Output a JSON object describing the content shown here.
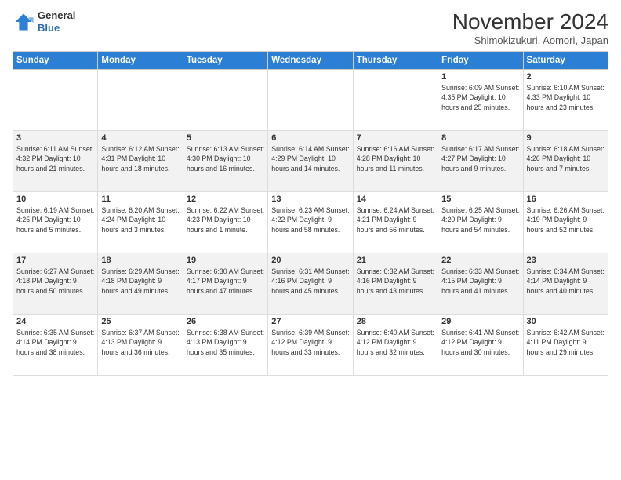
{
  "logo": {
    "general": "General",
    "blue": "Blue"
  },
  "title": "November 2024",
  "subtitle": "Shimokizukuri, Aomori, Japan",
  "days_of_week": [
    "Sunday",
    "Monday",
    "Tuesday",
    "Wednesday",
    "Thursday",
    "Friday",
    "Saturday"
  ],
  "weeks": [
    [
      {
        "day": "",
        "info": ""
      },
      {
        "day": "",
        "info": ""
      },
      {
        "day": "",
        "info": ""
      },
      {
        "day": "",
        "info": ""
      },
      {
        "day": "",
        "info": ""
      },
      {
        "day": "1",
        "info": "Sunrise: 6:09 AM\nSunset: 4:35 PM\nDaylight: 10 hours and 25 minutes."
      },
      {
        "day": "2",
        "info": "Sunrise: 6:10 AM\nSunset: 4:33 PM\nDaylight: 10 hours and 23 minutes."
      }
    ],
    [
      {
        "day": "3",
        "info": "Sunrise: 6:11 AM\nSunset: 4:32 PM\nDaylight: 10 hours and 21 minutes."
      },
      {
        "day": "4",
        "info": "Sunrise: 6:12 AM\nSunset: 4:31 PM\nDaylight: 10 hours and 18 minutes."
      },
      {
        "day": "5",
        "info": "Sunrise: 6:13 AM\nSunset: 4:30 PM\nDaylight: 10 hours and 16 minutes."
      },
      {
        "day": "6",
        "info": "Sunrise: 6:14 AM\nSunset: 4:29 PM\nDaylight: 10 hours and 14 minutes."
      },
      {
        "day": "7",
        "info": "Sunrise: 6:16 AM\nSunset: 4:28 PM\nDaylight: 10 hours and 11 minutes."
      },
      {
        "day": "8",
        "info": "Sunrise: 6:17 AM\nSunset: 4:27 PM\nDaylight: 10 hours and 9 minutes."
      },
      {
        "day": "9",
        "info": "Sunrise: 6:18 AM\nSunset: 4:26 PM\nDaylight: 10 hours and 7 minutes."
      }
    ],
    [
      {
        "day": "10",
        "info": "Sunrise: 6:19 AM\nSunset: 4:25 PM\nDaylight: 10 hours and 5 minutes."
      },
      {
        "day": "11",
        "info": "Sunrise: 6:20 AM\nSunset: 4:24 PM\nDaylight: 10 hours and 3 minutes."
      },
      {
        "day": "12",
        "info": "Sunrise: 6:22 AM\nSunset: 4:23 PM\nDaylight: 10 hours and 1 minute."
      },
      {
        "day": "13",
        "info": "Sunrise: 6:23 AM\nSunset: 4:22 PM\nDaylight: 9 hours and 58 minutes."
      },
      {
        "day": "14",
        "info": "Sunrise: 6:24 AM\nSunset: 4:21 PM\nDaylight: 9 hours and 56 minutes."
      },
      {
        "day": "15",
        "info": "Sunrise: 6:25 AM\nSunset: 4:20 PM\nDaylight: 9 hours and 54 minutes."
      },
      {
        "day": "16",
        "info": "Sunrise: 6:26 AM\nSunset: 4:19 PM\nDaylight: 9 hours and 52 minutes."
      }
    ],
    [
      {
        "day": "17",
        "info": "Sunrise: 6:27 AM\nSunset: 4:18 PM\nDaylight: 9 hours and 50 minutes."
      },
      {
        "day": "18",
        "info": "Sunrise: 6:29 AM\nSunset: 4:18 PM\nDaylight: 9 hours and 49 minutes."
      },
      {
        "day": "19",
        "info": "Sunrise: 6:30 AM\nSunset: 4:17 PM\nDaylight: 9 hours and 47 minutes."
      },
      {
        "day": "20",
        "info": "Sunrise: 6:31 AM\nSunset: 4:16 PM\nDaylight: 9 hours and 45 minutes."
      },
      {
        "day": "21",
        "info": "Sunrise: 6:32 AM\nSunset: 4:16 PM\nDaylight: 9 hours and 43 minutes."
      },
      {
        "day": "22",
        "info": "Sunrise: 6:33 AM\nSunset: 4:15 PM\nDaylight: 9 hours and 41 minutes."
      },
      {
        "day": "23",
        "info": "Sunrise: 6:34 AM\nSunset: 4:14 PM\nDaylight: 9 hours and 40 minutes."
      }
    ],
    [
      {
        "day": "24",
        "info": "Sunrise: 6:35 AM\nSunset: 4:14 PM\nDaylight: 9 hours and 38 minutes."
      },
      {
        "day": "25",
        "info": "Sunrise: 6:37 AM\nSunset: 4:13 PM\nDaylight: 9 hours and 36 minutes."
      },
      {
        "day": "26",
        "info": "Sunrise: 6:38 AM\nSunset: 4:13 PM\nDaylight: 9 hours and 35 minutes."
      },
      {
        "day": "27",
        "info": "Sunrise: 6:39 AM\nSunset: 4:12 PM\nDaylight: 9 hours and 33 minutes."
      },
      {
        "day": "28",
        "info": "Sunrise: 6:40 AM\nSunset: 4:12 PM\nDaylight: 9 hours and 32 minutes."
      },
      {
        "day": "29",
        "info": "Sunrise: 6:41 AM\nSunset: 4:12 PM\nDaylight: 9 hours and 30 minutes."
      },
      {
        "day": "30",
        "info": "Sunrise: 6:42 AM\nSunset: 4:11 PM\nDaylight: 9 hours and 29 minutes."
      }
    ]
  ]
}
